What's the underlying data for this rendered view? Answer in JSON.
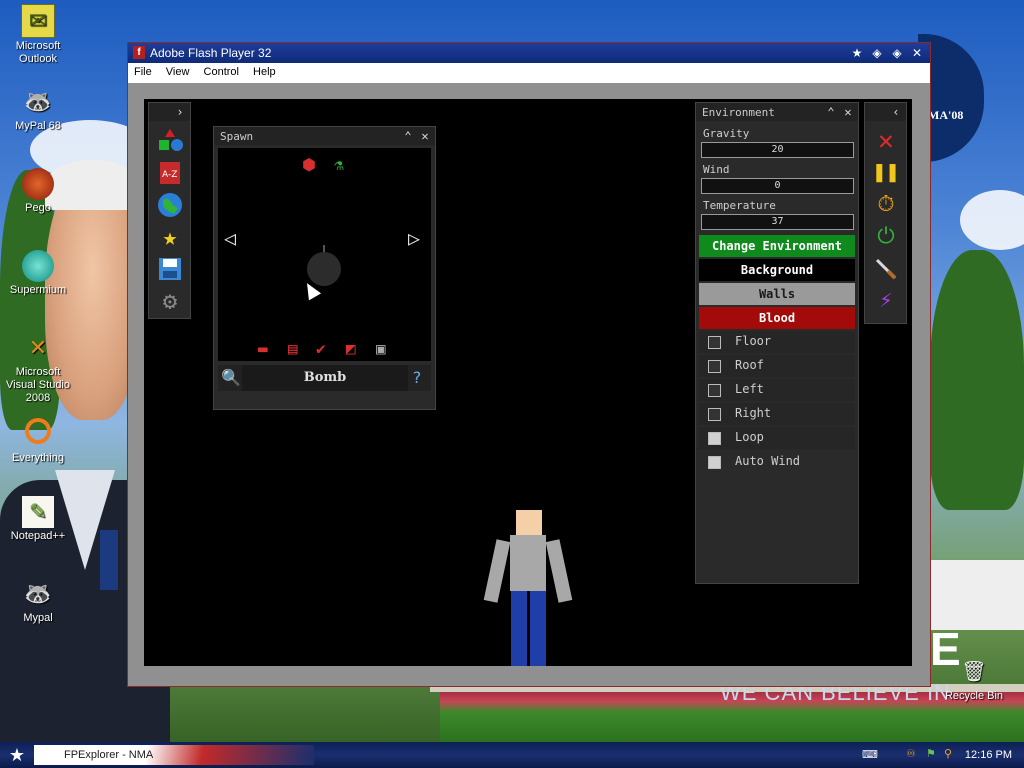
{
  "desktop": {
    "icons": [
      {
        "label": "Microsoft Outlook",
        "icon": "outlook-icon"
      },
      {
        "label": "MyPal 68",
        "icon": "mypal-icon"
      },
      {
        "label": "Pego",
        "icon": "pego-icon"
      },
      {
        "label": "Supermium",
        "icon": "supermium-icon"
      },
      {
        "label": "Microsoft Visual Studio 2008",
        "icon": "visual-studio-icon"
      },
      {
        "label": "Everything",
        "icon": "everything-icon"
      },
      {
        "label": "Notepad++",
        "icon": "notepadpp-icon"
      },
      {
        "label": "Mypal",
        "icon": "mypal-icon"
      }
    ],
    "wallpaper_text": "WE CAN BELIEVE IN",
    "badge_text": "MA'08",
    "recycle_bin": "Recycle Bin"
  },
  "window": {
    "title": "Adobe Flash Player 32",
    "menu": [
      "File",
      "View",
      "Control",
      "Help"
    ]
  },
  "spawn_panel": {
    "title": "Spawn",
    "selected_item": "Bomb"
  },
  "environment_panel": {
    "title": "Environment",
    "gravity_label": "Gravity",
    "gravity_value": "20",
    "wind_label": "Wind",
    "wind_value": "0",
    "temperature_label": "Temperature",
    "temperature_value": "37",
    "buttons": [
      {
        "label": "Change Environment",
        "bg": "#0f8a1c",
        "fg": "#ffffff"
      },
      {
        "label": "Background",
        "bg": "#000000",
        "fg": "#ffffff"
      },
      {
        "label": "Walls",
        "bg": "#9a9a9a",
        "fg": "#1a1a1a"
      },
      {
        "label": "Blood",
        "bg": "#a30a0a",
        "fg": "#ffffff"
      }
    ],
    "checkboxes": [
      "Floor",
      "Roof",
      "Left",
      "Right",
      "Loop",
      "Auto Wind"
    ]
  },
  "taskbar": {
    "task_label": "FPExplorer - NMA",
    "clock": "12:16 PM"
  }
}
